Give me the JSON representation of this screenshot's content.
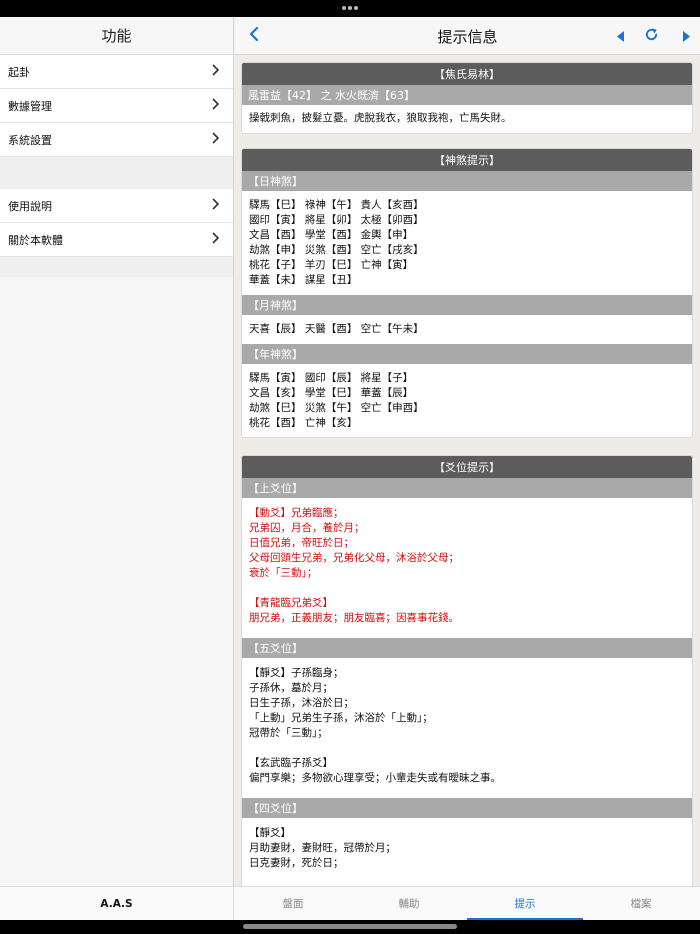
{
  "sidebar": {
    "title": "功能",
    "group1": [
      "起卦",
      "數據管理",
      "系統設置"
    ],
    "group2": [
      "使用說明",
      "關於本軟體"
    ]
  },
  "main": {
    "title": "提示信息"
  },
  "cards": {
    "jiaoshi": {
      "header": "【焦氏易林】",
      "sub": "風雷益【42】 之 水火既濟【63】",
      "body": "操戟刺魚，披髮立憂。虎脫我衣，狼取我袍，亡馬失財。"
    },
    "shensha": {
      "header": "【神煞提示】",
      "day_title": "【日神煞】",
      "day_lines": [
        "驛馬【巳】 祿神【午】 貴人【亥酉】",
        "國印【寅】 將星【卯】 太極【卯酉】",
        "文昌【酉】 學堂【酉】 金輿【申】",
        "劫煞【申】 災煞【酉】 空亡【戌亥】",
        "桃花【子】 羊刃【巳】 亡神【寅】",
        "華蓋【未】 謀星【丑】"
      ],
      "month_title": "【月神煞】",
      "month_lines": [
        "天喜【辰】 天醫【酉】 空亡【午未】"
      ],
      "year_title": "【年神煞】",
      "year_lines": [
        "驛馬【寅】 國印【辰】 將星【子】",
        "文昌【亥】 學堂【巳】 華蓋【辰】",
        "劫煞【巳】 災煞【午】 空亡【申酉】",
        "桃花【酉】 亡神【亥】"
      ]
    },
    "yaowei": {
      "header": "【爻位提示】",
      "top_title": "【上爻位】",
      "top_lines": [
        "【動爻】兄弟臨應；",
        "兄弟囚，月合，養於月；",
        "日值兄弟，帝旺於日；",
        "父母回頭生兄弟，兄弟化父母，沐浴於父母；",
        "衰於「三動」；"
      ],
      "top_lines2": [
        "【青龍臨兄弟爻】",
        "朋兄弟，正義朋友；朋友臨喜；因喜事花錢。"
      ],
      "fifth_title": "【五爻位】",
      "fifth_lines": [
        "【靜爻】子孫臨身；",
        "子孫休，墓於月；",
        "日生子孫，沐浴於日；",
        "「上動」兄弟生子孫，沐浴於「上動」；",
        "冠帶於「三動」；"
      ],
      "fifth_lines2": [
        "【玄武臨子孫爻】",
        "偏門享樂；多物欲心理享受；小輩走失或有曖昧之事。"
      ],
      "fourth_title": "【四爻位】",
      "fourth_lines": [
        "【靜爻】",
        "月助妻財，妻財旺，冠帶於月；",
        "日克妻財，死於日；"
      ]
    }
  },
  "tabbar": {
    "app_label": "A.A.S",
    "tabs": [
      "盤面",
      "輔助",
      "提示",
      "檔案"
    ],
    "active_tab": "提示"
  },
  "colors": {
    "accent": "#1a73d9",
    "header_dark": "#5c5c5c",
    "header_grey": "#a9a9a9",
    "highlight_red": "#d10f0f"
  },
  "icons": {
    "back": "chevron-left-icon",
    "prev": "triangle-left-icon",
    "refresh": "refresh-icon",
    "next": "triangle-right-icon",
    "row_chevron": "chevron-right-icon"
  }
}
